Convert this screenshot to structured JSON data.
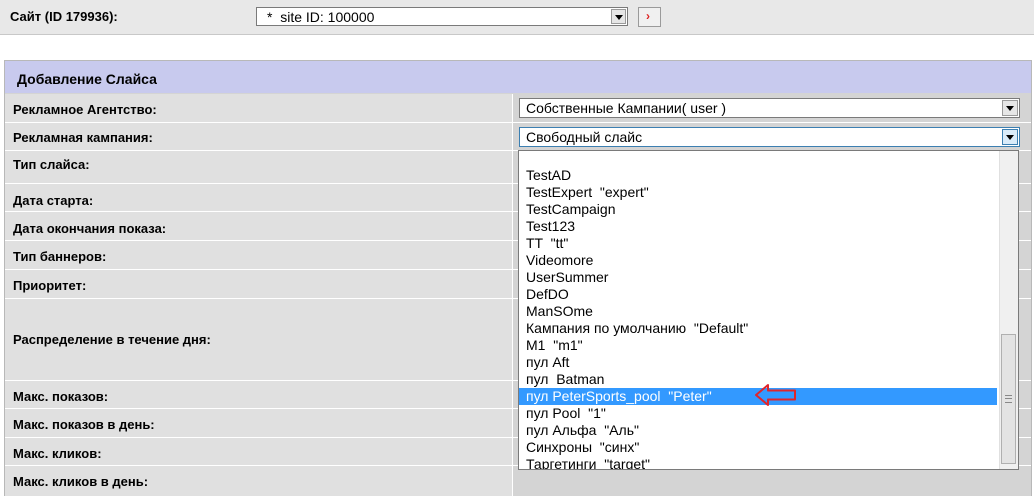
{
  "site": {
    "label": "Сайт (ID 179936):",
    "selected": "*  site ID: 100000",
    "go_icon": "go-arrow-icon"
  },
  "panel": {
    "title": "Добавление Слайса"
  },
  "form": {
    "agency_label": "Рекламное Агентство:",
    "agency_value": "Собственные Кампании( user )",
    "campaign_label": "Рекламная кампания:",
    "campaign_value": "Свободный слайс",
    "slice_type_label": "Тип слайса:",
    "start_date_label": "Дата старта:",
    "end_date_label": "Дата окончания показа:",
    "banner_type_label": "Тип баннеров:",
    "priority_label": "Приоритет:",
    "day_distribution_label": "Распределение в течение дня:",
    "max_shows_label": "Макс. показов:",
    "max_shows_day_label": "Макс. показов в день:",
    "max_clicks_label": "Макс. кликов:",
    "max_clicks_day_label": "Макс. кликов в день:"
  },
  "dropdown": {
    "options": [
      "TestAD",
      "TestExpert  \"expert\"",
      "TestCampaign",
      "Test123",
      "TT  \"tt\"",
      "Videomore",
      "UserSummer",
      "DefDO",
      "ManSOme",
      "Кампания по умолчанию  \"Default\"",
      "M1  \"m1\"",
      "пул Aft",
      "пул  Batman",
      "пул PeterSports_pool  \"Peter\"",
      "пул Pool  \"1\"",
      "пул Альфа  \"Аль\"",
      "Синхроны  \"синх\"",
      "Таргетинги  \"target\""
    ],
    "selected_index": 13
  },
  "colors": {
    "panel_header": "#c8caee",
    "selection": "#3399ff",
    "annotation": "#e0252b"
  }
}
